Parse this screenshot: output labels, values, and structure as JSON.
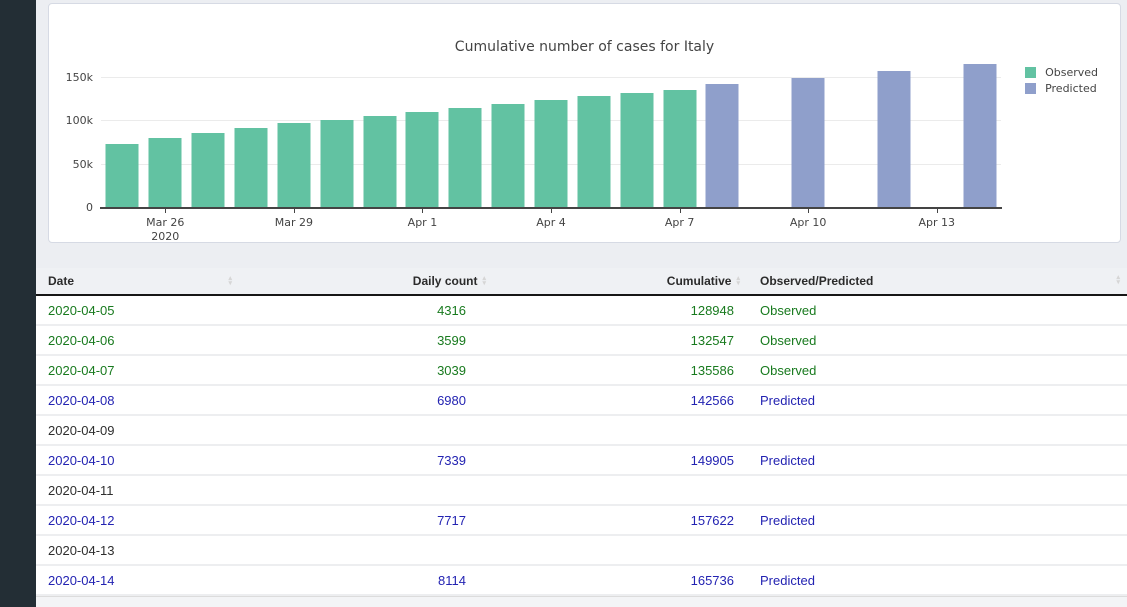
{
  "chart_data": {
    "type": "bar",
    "title": "Cumulative number of cases for Italy",
    "xlabel": "",
    "ylabel": "",
    "ylim": [
      0,
      170000
    ],
    "grid": true,
    "legend_position": "top-right",
    "y_tick_values": [
      0,
      50000,
      100000,
      150000
    ],
    "y_tick_labels": [
      "0",
      "50k",
      "100k",
      "150k"
    ],
    "ticks": [
      {
        "date": "2020-03-26",
        "label": "Mar 26",
        "sub": "2020"
      },
      {
        "date": "2020-03-29",
        "label": "Mar 29"
      },
      {
        "date": "2020-04-01",
        "label": "Apr 1"
      },
      {
        "date": "2020-04-04",
        "label": "Apr 4"
      },
      {
        "date": "2020-04-07",
        "label": "Apr 7"
      },
      {
        "date": "2020-04-10",
        "label": "Apr 10"
      },
      {
        "date": "2020-04-13",
        "label": "Apr 13"
      }
    ],
    "x_range": [
      "2020-03-25",
      "2020-04-14"
    ],
    "series": [
      {
        "name": "Observed",
        "color": "#62c2a2",
        "x": [
          "2020-03-25",
          "2020-03-26",
          "2020-03-27",
          "2020-03-28",
          "2020-03-29",
          "2020-03-30",
          "2020-03-31",
          "2020-04-01",
          "2020-04-02",
          "2020-04-03",
          "2020-04-04",
          "2020-04-05",
          "2020-04-06",
          "2020-04-07"
        ],
        "values": [
          74386,
          80539,
          86498,
          92472,
          97689,
          101739,
          105792,
          110574,
          115242,
          119827,
          124632,
          128948,
          132547,
          135586
        ]
      },
      {
        "name": "Predicted",
        "color": "#8f9fcb",
        "x": [
          "2020-04-08",
          "2020-04-10",
          "2020-04-12",
          "2020-04-14"
        ],
        "values": [
          142566,
          149905,
          157622,
          165736
        ]
      }
    ]
  },
  "table": {
    "headers": [
      "Date",
      "Daily count",
      "Cumulative",
      "Observed/Predicted"
    ],
    "rows": [
      {
        "date": "2020-04-05",
        "daily": "4316",
        "cumulative": "128948",
        "type": "Observed",
        "status": "observed"
      },
      {
        "date": "2020-04-06",
        "daily": "3599",
        "cumulative": "132547",
        "type": "Observed",
        "status": "observed"
      },
      {
        "date": "2020-04-07",
        "daily": "3039",
        "cumulative": "135586",
        "type": "Observed",
        "status": "observed"
      },
      {
        "date": "2020-04-08",
        "daily": "6980",
        "cumulative": "142566",
        "type": "Predicted",
        "status": "predicted"
      },
      {
        "date": "2020-04-09",
        "daily": "",
        "cumulative": "",
        "type": "",
        "status": "empty"
      },
      {
        "date": "2020-04-10",
        "daily": "7339",
        "cumulative": "149905",
        "type": "Predicted",
        "status": "predicted"
      },
      {
        "date": "2020-04-11",
        "daily": "",
        "cumulative": "",
        "type": "",
        "status": "empty"
      },
      {
        "date": "2020-04-12",
        "daily": "7717",
        "cumulative": "157622",
        "type": "Predicted",
        "status": "predicted"
      },
      {
        "date": "2020-04-13",
        "daily": "",
        "cumulative": "",
        "type": "",
        "status": "empty"
      },
      {
        "date": "2020-04-14",
        "daily": "8114",
        "cumulative": "165736",
        "type": "Predicted",
        "status": "predicted"
      }
    ]
  }
}
